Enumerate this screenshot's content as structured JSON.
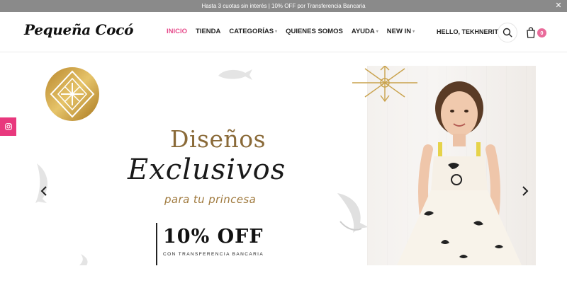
{
  "promo": {
    "text": "Hasta 3 cuotas sin interés | 10% OFF por Transferencia Bancaria",
    "close_icon": "close-icon"
  },
  "header": {
    "logo": "Pequeña Cocó",
    "nav": [
      {
        "label": "INICIO",
        "active": true,
        "dropdown": false
      },
      {
        "label": "TIENDA",
        "active": false,
        "dropdown": false
      },
      {
        "label": "CATEGORÍAS",
        "active": false,
        "dropdown": true
      },
      {
        "label": "QUIENES SOMOS",
        "active": false,
        "dropdown": false
      },
      {
        "label": "AYUDA",
        "active": false,
        "dropdown": true
      },
      {
        "label": "NEW IN",
        "active": false,
        "dropdown": true
      }
    ],
    "greeting": "HELLO, TEKHNERIT",
    "cart_count": "0",
    "accent_color": "#e64b8b"
  },
  "hero": {
    "title_line1": "Diseños",
    "title_line2": "Exclusivos",
    "subtitle": "para tu princesa",
    "offer": "10% OFF",
    "offer_sub": "CON TRANSFERENCIA BANCARIA",
    "prev_icon": "chevron-left-icon",
    "next_icon": "chevron-right-icon"
  },
  "social": {
    "icon": "instagram-icon"
  }
}
